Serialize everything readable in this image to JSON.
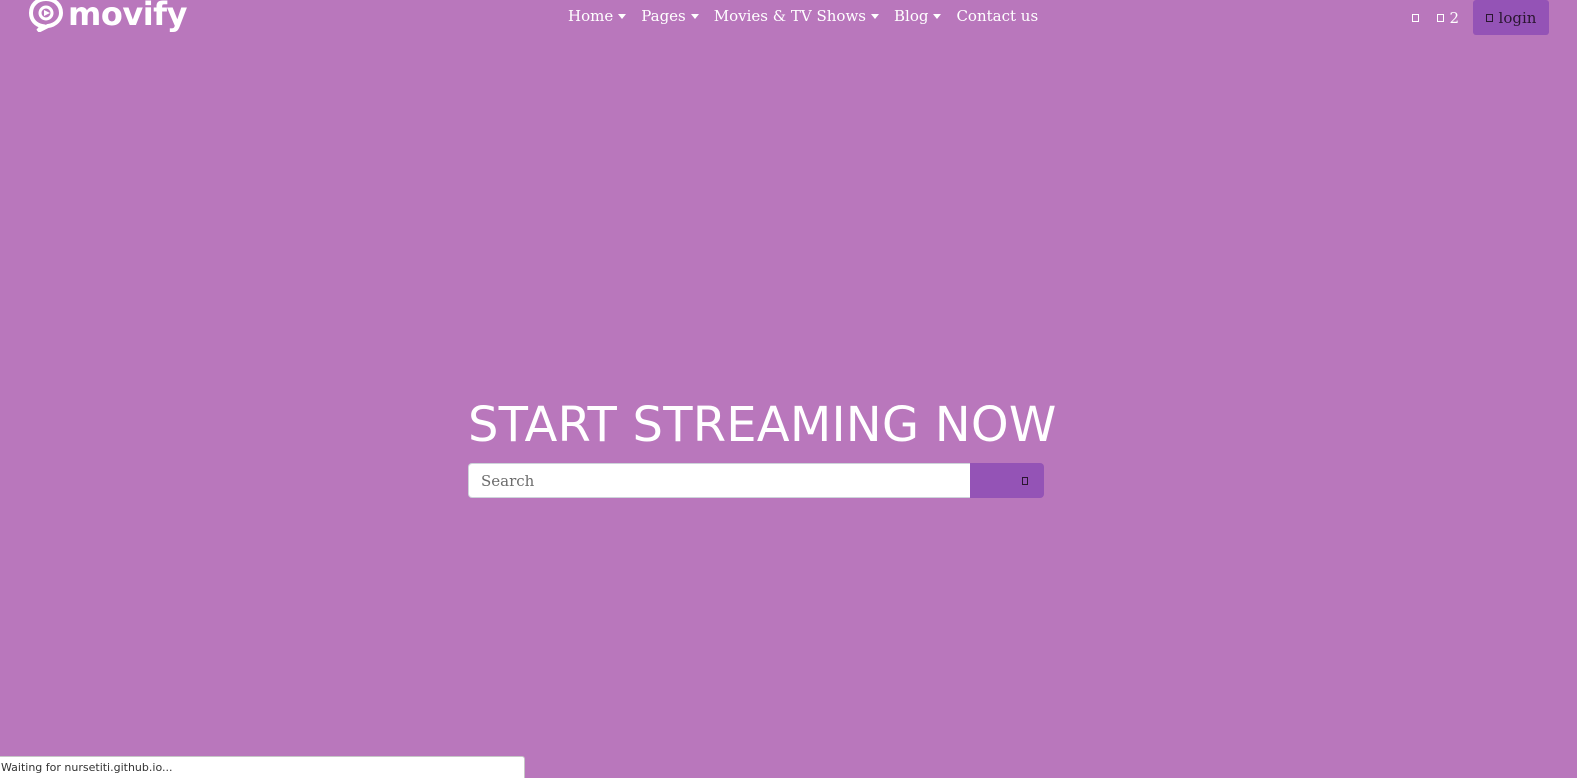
{
  "brand": {
    "name": "movify"
  },
  "nav": {
    "items": [
      {
        "label": "Home",
        "dropdown": true
      },
      {
        "label": "Pages",
        "dropdown": true
      },
      {
        "label": "Movies & TV Shows",
        "dropdown": true
      },
      {
        "label": "Blog",
        "dropdown": true
      },
      {
        "label": "Contact us",
        "dropdown": false
      }
    ]
  },
  "header": {
    "user_icon": "user-icon",
    "cart_icon": "cart-icon",
    "cart_count": "2",
    "login_label": "login"
  },
  "hero": {
    "title": "START STREAMING NOW",
    "search_placeholder": "Search"
  },
  "status": {
    "text": "Waiting for nursetiti.github.io..."
  },
  "colors": {
    "background": "#b977bc",
    "accent": "#9453b6",
    "text": "#ffffff"
  }
}
